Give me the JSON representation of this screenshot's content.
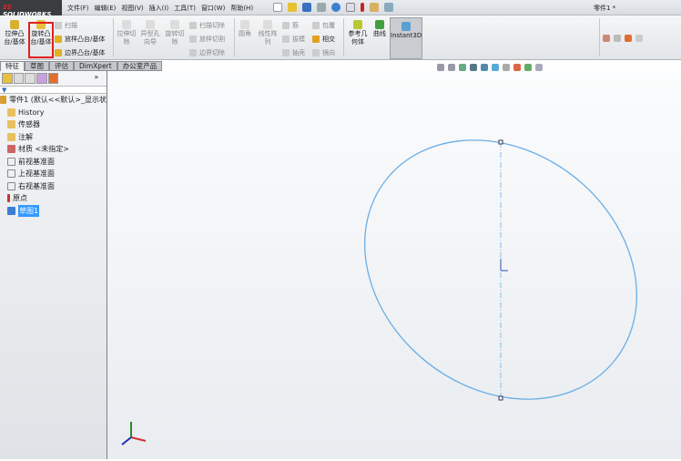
{
  "app": {
    "logo": "SOLIDWORKS",
    "document_title": "零件1 *"
  },
  "menu": [
    "文件(F)",
    "编辑(E)",
    "视图(V)",
    "插入(I)",
    "工具(T)",
    "窗口(W)",
    "帮助(H)"
  ],
  "ribbon": {
    "extrude_boss": "拉伸凸台/基体",
    "revolve_boss": "旋转凸台/基体",
    "sweep": "扫描",
    "loft_boss": "放样凸台/基体",
    "boundary_boss": "边界凸台/基体",
    "extrude_cut": "拉伸切除",
    "hole_wizard": "异型孔向导",
    "revolve_cut": "旋转切除",
    "swept_cut": "扫描切除",
    "lofted_cut": "放样切割",
    "boundary_cut": "边界切除",
    "fillet": "圆角",
    "linear_pattern": "线性阵列",
    "rib": "筋",
    "draft": "拔模",
    "shell": "抽壳",
    "wrap": "包覆",
    "intersect": "相交",
    "mirror": "镜向",
    "ref_geometry": "参考几何体",
    "curves": "曲线",
    "instant3d": "Instant3D"
  },
  "tabs": [
    "特征",
    "草图",
    "评估",
    "DimXpert",
    "办公室产品"
  ],
  "tree": {
    "root": "零件1 (默认<<默认>_显示状",
    "items": [
      "History",
      "传感器",
      "注解",
      "材质 <未指定>",
      "前视基准面",
      "上视基准面",
      "右视基准面",
      "原点",
      "草图1"
    ]
  },
  "colors": {
    "sketch": "#6aaee6",
    "highlight": "#e02020",
    "selection": "#3399ff"
  }
}
